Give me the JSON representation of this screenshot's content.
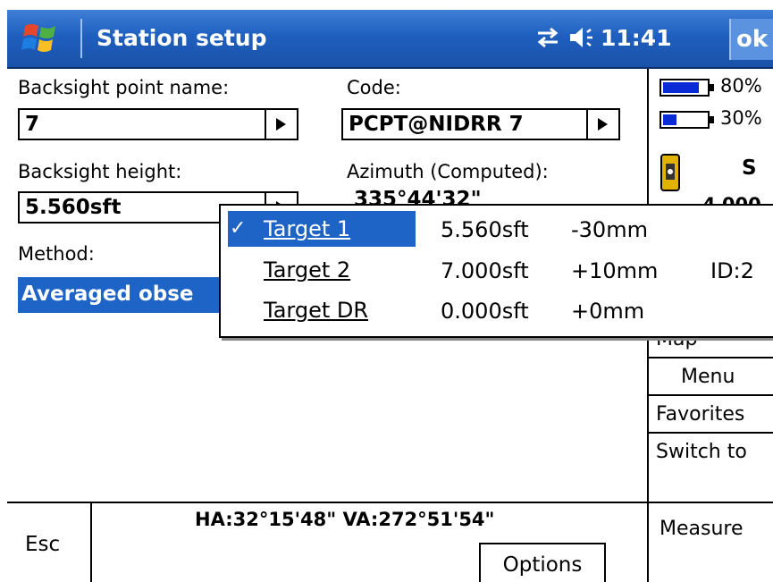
{
  "titlebar": {
    "title": "Station setup",
    "time": "11:41",
    "ok_label": "ok"
  },
  "form": {
    "backsight_name_label": "Backsight point name:",
    "backsight_name_value": "7",
    "code_label": "Code:",
    "code_value": "PCPT@NIDRR 7",
    "backsight_height_label": "Backsight height:",
    "backsight_height_value": "5.560sft",
    "azimuth_label": "Azimuth (Computed):",
    "azimuth_value": "335°44'32\"",
    "method_label": "Method:",
    "method_value": "Averaged obse"
  },
  "right_panel": {
    "battery1_pct": "80%",
    "battery1_level": 0.8,
    "battery2_pct": "30%",
    "battery2_level": 0.3,
    "instrument_text": "S",
    "partial_text": "4 000",
    "buttons": [
      "Map",
      "Menu",
      "Favorites",
      "Switch to",
      "Measure"
    ]
  },
  "target_popup": {
    "rows": [
      {
        "name": "Target 1",
        "height": "5.560sft",
        "offset": "-30mm",
        "id": "",
        "selected": true
      },
      {
        "name": "Target 2",
        "height": "7.000sft",
        "offset": "+10mm",
        "id": "ID:2",
        "selected": false
      },
      {
        "name": "Target DR",
        "height": "0.000sft",
        "offset": "+0mm",
        "id": "",
        "selected": false
      }
    ]
  },
  "bottom": {
    "esc_label": "Esc",
    "angles": "HA:32°15'48\"  VA:272°51'54\"",
    "options_label": "Options"
  },
  "colors": {
    "titlebar": "#1f5fbf",
    "selection": "#1e63c6",
    "battery": "#0a2ad6"
  },
  "icons": [
    "windows-logo-icon",
    "connectivity-icon",
    "volume-icon",
    "instrument-icon",
    "checkmark-icon"
  ]
}
